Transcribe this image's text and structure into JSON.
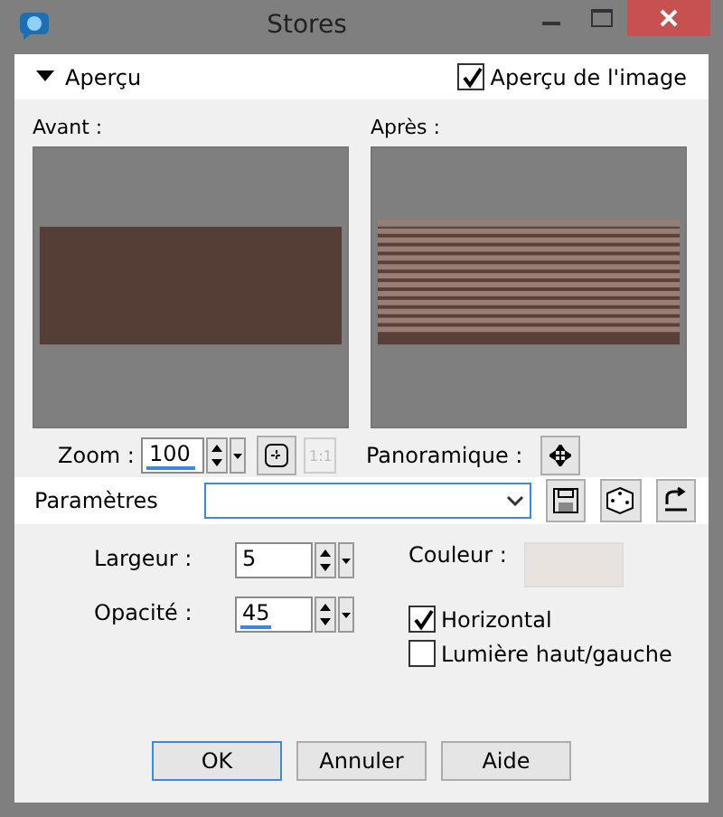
{
  "window": {
    "title": "Stores"
  },
  "preview_header": {
    "label": "Aperçu",
    "expanded": true,
    "image_preview": {
      "label": "Aperçu de l'image",
      "checked": true
    }
  },
  "before": {
    "label": "Avant :"
  },
  "after": {
    "label": "Après :"
  },
  "zoom": {
    "label": "Zoom :",
    "value": "100",
    "level": 0.9,
    "actual_size": {
      "label": "1:1",
      "disabled": true
    }
  },
  "pan": {
    "label": "Panoramique :"
  },
  "presets": {
    "label": "Paramètres"
  },
  "settings": [
    {
      "kind": "spin",
      "label": "Largeur :",
      "value": "5"
    },
    {
      "kind": "spin",
      "label": "Opacité :",
      "value": "45",
      "level": 0.45
    }
  ],
  "color": {
    "label": "Couleur :",
    "color": "#e9e3df"
  },
  "options": [
    {
      "label": "Horizontal",
      "checked": true
    },
    {
      "label": "Lumière haut/gauche",
      "checked": false
    }
  ],
  "buttons": [
    {
      "label": "OK",
      "selected": true
    },
    {
      "label": "Annuler",
      "selected": false
    },
    {
      "label": "Aide",
      "selected": false
    }
  ]
}
